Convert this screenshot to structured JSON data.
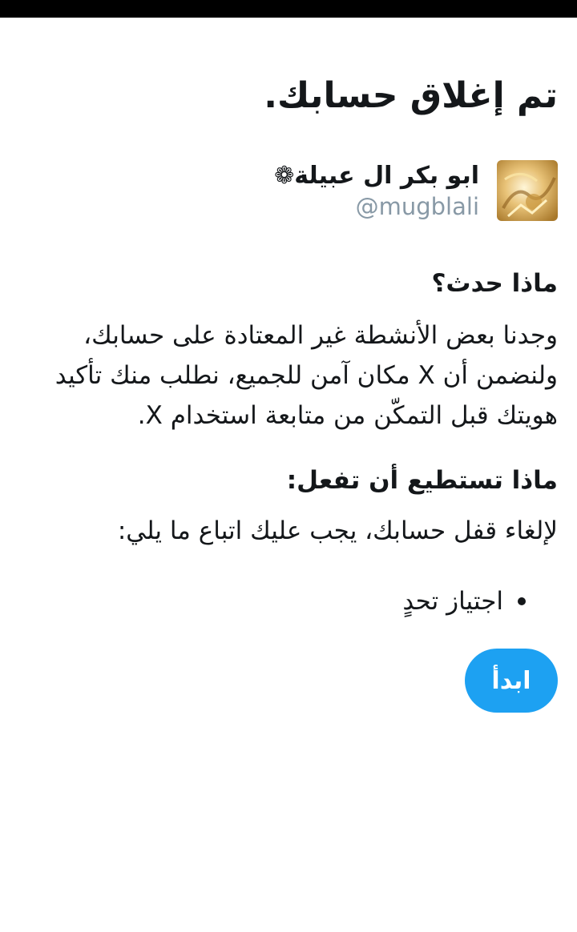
{
  "page": {
    "title": "تم إغلاق حسابك."
  },
  "account": {
    "display_name": "ابو بكر ال عبيلة❁",
    "username": "@mugblali",
    "avatar": "profile-photo"
  },
  "what_happened": {
    "heading": "ماذا حدث؟",
    "text": "وجدنا بعض الأنشطة غير المعتادة على حسابك، ولنضمن أن X مكان آمن للجميع، نطلب منك تأكيد هويتك قبل التمكّن من متابعة استخدام X."
  },
  "what_you_can_do": {
    "heading": "ماذا تستطيع أن تفعل:",
    "text": "لإلغاء قفل حسابك، يجب عليك اتباع ما يلي:",
    "steps": [
      "اجتياز تحدٍ"
    ]
  },
  "actions": {
    "start_label": "ابدأ"
  },
  "colors": {
    "accent": "#1da1f2",
    "text": "#14171a",
    "muted": "#8899a6",
    "status_bar": "#000000"
  }
}
